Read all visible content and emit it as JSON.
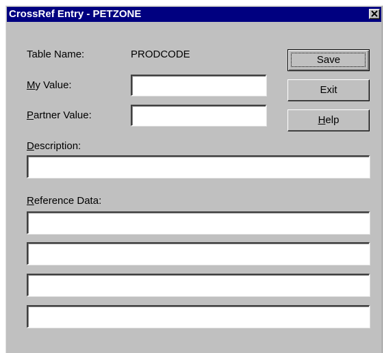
{
  "window": {
    "title": "CrossRef Entry - PETZONE",
    "close_icon": "close-icon"
  },
  "form": {
    "table_name_label": "Table Name:",
    "table_name_value": "PRODCODE",
    "my_value": {
      "label_accel": "M",
      "label_rest": "y Value:",
      "value": ""
    },
    "partner_value": {
      "label_accel": "P",
      "label_rest": "artner Value:",
      "value": ""
    },
    "description": {
      "label_accel": "D",
      "label_rest": "escription:",
      "value": ""
    },
    "reference_data": {
      "label_accel": "R",
      "label_rest": "eference Data:",
      "values": [
        "",
        "",
        "",
        ""
      ]
    }
  },
  "buttons": {
    "save": "Save",
    "exit": "Exit",
    "help_accel": "H",
    "help_rest": "elp"
  }
}
